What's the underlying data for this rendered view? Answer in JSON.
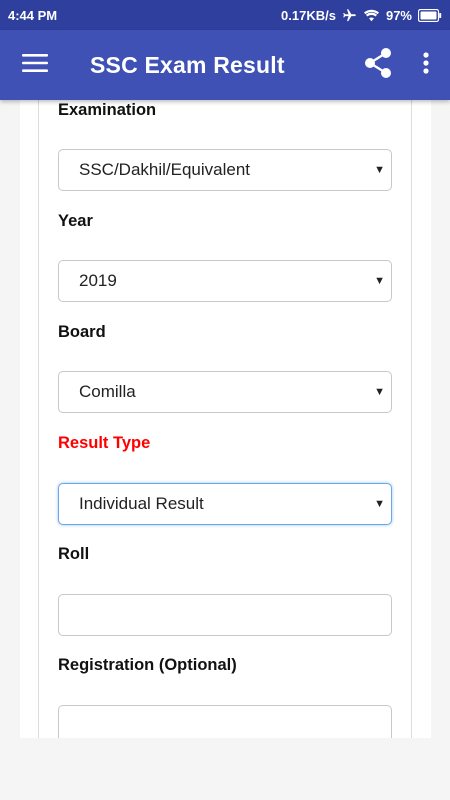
{
  "status_bar": {
    "time": "4:44 PM",
    "net_speed": "0.17KB/s",
    "battery": "97%"
  },
  "app_bar": {
    "title": "SSC Exam Result",
    "menu_icon": "hamburger-menu-icon",
    "share_icon": "share-icon",
    "more_icon": "more-vert-icon"
  },
  "form": {
    "examination": {
      "label": "Examination",
      "value": "SSC/Dakhil/Equivalent"
    },
    "year": {
      "label": "Year",
      "value": "2019"
    },
    "board": {
      "label": "Board",
      "value": "Comilla"
    },
    "result_type": {
      "label": "Result Type",
      "value": "Individual Result"
    },
    "roll": {
      "label": "Roll",
      "value": ""
    },
    "registration": {
      "label": "Registration (Optional)",
      "value": ""
    },
    "caret": "▼"
  },
  "colors": {
    "status_bar": "#2f3f9e",
    "app_bar": "#3f51b5",
    "highlight_label": "#ff0000",
    "focus_border": "#6ca6ea"
  }
}
